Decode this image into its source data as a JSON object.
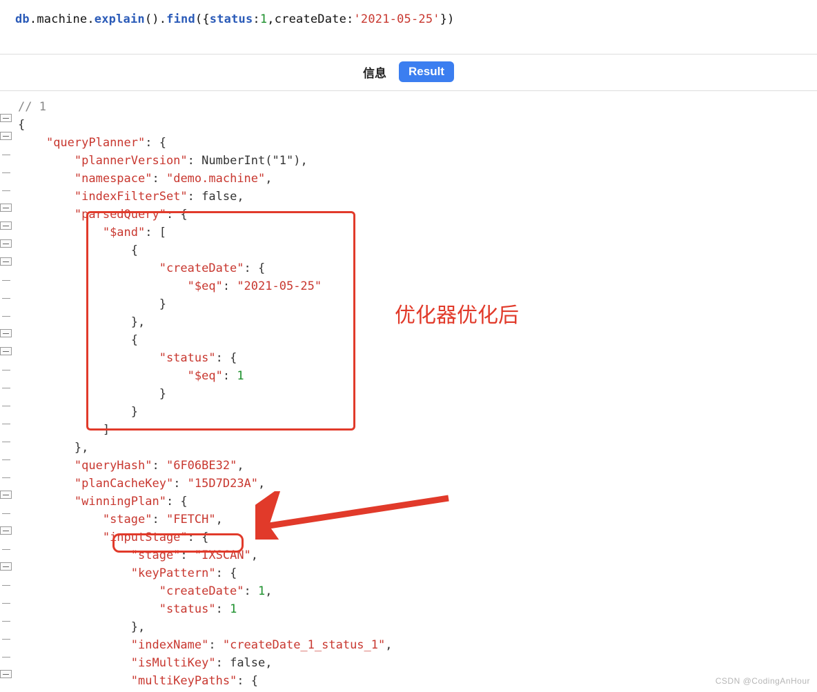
{
  "query": {
    "db": "db",
    "coll": "machine",
    "m1": "explain",
    "m2": "find",
    "prop1": "status",
    "val1": "1",
    "prop2": "createDate",
    "val2": "'2021-05-25'"
  },
  "tabs": {
    "info": "信息",
    "result": "Result"
  },
  "comment": "// 1",
  "lines": {
    "qp": "\"queryPlanner\"",
    "pv_k": "\"plannerVersion\"",
    "pv_v": "NumberInt(\"1\")",
    "ns_k": "\"namespace\"",
    "ns_v": "\"demo.machine\"",
    "ifs_k": "\"indexFilterSet\"",
    "ifs_v": "false",
    "pq_k": "\"parsedQuery\"",
    "and_k": "\"$and\"",
    "cd_k": "\"createDate\"",
    "eq_k": "\"$eq\"",
    "cd_v": "\"2021-05-25\"",
    "st_k": "\"status\"",
    "st_v": "1",
    "qh_k": "\"queryHash\"",
    "qh_v": "\"6F06BE32\"",
    "pck_k": "\"planCacheKey\"",
    "pck_v": "\"15D7D23A\"",
    "wp_k": "\"winningPlan\"",
    "stage_k": "\"stage\"",
    "fetch_v": "\"FETCH\"",
    "is_k": "\"inputStage\"",
    "ixscan_v": "\"IXSCAN\"",
    "kp_k": "\"keyPattern\"",
    "kp_cd_v": "1",
    "kp_st_v": "1",
    "ixn_k": "\"indexName\"",
    "ixn_v": "\"createDate_1_status_1\"",
    "imk_k": "\"isMultiKey\"",
    "imk_v": "false",
    "mkp_k": "\"multiKeyPaths\""
  },
  "annotations": {
    "label1": "优化器优化后",
    "watermark": "CSDN @CodingAnHour"
  }
}
